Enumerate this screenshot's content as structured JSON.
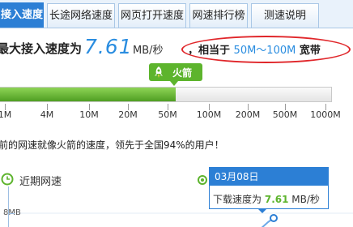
{
  "tabs": [
    {
      "label": "接入速度",
      "active": true
    },
    {
      "label": "长途网络速度",
      "active": false
    },
    {
      "label": "网页打开速度",
      "active": false
    },
    {
      "label": "网速排行榜",
      "active": false
    },
    {
      "label": "测速说明",
      "active": false
    }
  ],
  "headline": {
    "label": "最大接入速度为",
    "value": "7.61",
    "unit": "MB/秒",
    "equiv_prefix": "，相当于",
    "equiv_range": "50M～100M",
    "equiv_suffix": "宽带"
  },
  "speed_bar": {
    "badge_label": "火箭",
    "fill_fraction": 0.53,
    "ticks": [
      "1M",
      "4M",
      "10M",
      "20M",
      "50M",
      "100M",
      "200M",
      "500M",
      "1000M"
    ]
  },
  "comparison_text": "前的网速就像火箭的速度，领先于全国94%的用户！",
  "recent": {
    "title": "近期网速",
    "y_label": "8MB"
  },
  "tooltip": {
    "date": "03月08日",
    "label": "下载速度为",
    "value": "7.61",
    "unit": "MB/秒"
  },
  "colors": {
    "accent_blue": "#2c7fd5",
    "value_blue": "#2a8de0",
    "green": "#5db42d",
    "highlight_red": "#e0262a"
  }
}
